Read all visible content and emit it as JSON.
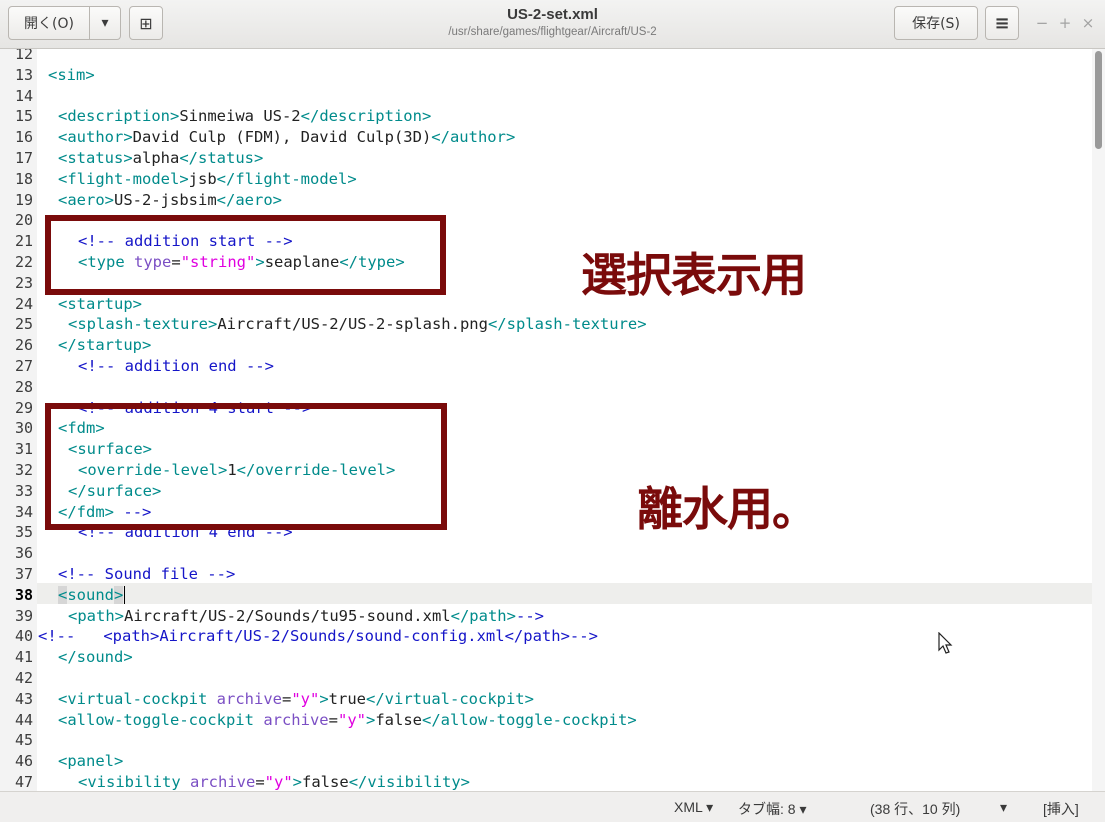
{
  "header": {
    "open_label": "開く(O)",
    "dropdown_glyph": "▾",
    "new_tab_glyph": "⊞",
    "title": "US-2-set.xml",
    "subtitle": "/usr/share/games/flightgear/Aircraft/US-2",
    "save_label": "保存(S)",
    "menu_glyph": "≡",
    "minimize_glyph": "−",
    "maximize_glyph": "+",
    "close_glyph": "×"
  },
  "editor": {
    "line_numbers": [
      "12",
      "13",
      "14",
      "15",
      "16",
      "17",
      "18",
      "19",
      "20",
      "21",
      "22",
      "23",
      "24",
      "25",
      "26",
      "27",
      "28",
      "29",
      "30",
      "31",
      "32",
      "33",
      "34",
      "35",
      "36",
      "37",
      "38",
      "39",
      "40",
      "41",
      "42",
      "43",
      "44",
      "45",
      "46",
      "47"
    ],
    "current_line": "38",
    "lines": [
      {
        "text": "<sim>"
      },
      {
        "text": "<description>Sinmeiwa US-2</description>"
      },
      {
        "text": "<author>David Culp (FDM), David Culp(3D)</author>"
      },
      {
        "text": "<status>alpha</status>"
      },
      {
        "text": "<flight-model>jsb</flight-model>"
      },
      {
        "text": "<aero>US-2-jsbsim</aero>"
      },
      {
        "text": "<!-- addition start -->"
      },
      {
        "text": "<type type=\"string\">seaplane</type>"
      },
      {
        "text": "<startup>"
      },
      {
        "text": "<splash-texture>Aircraft/US-2/US-2-splash.png</splash-texture>"
      },
      {
        "text": "</startup>"
      },
      {
        "text": "<!-- addition end -->"
      },
      {
        "text": "<!-- addition 4 start -->"
      },
      {
        "text": "<fdm>"
      },
      {
        "text": "<surface>"
      },
      {
        "text": "<override-level>1</override-level>"
      },
      {
        "text": "</surface>"
      },
      {
        "text": "</fdm> -->"
      },
      {
        "text": "<!-- addition 4 end -->"
      },
      {
        "text": "<!-- Sound file -->"
      },
      {
        "text": "<sound>"
      },
      {
        "text": "<path>Aircraft/US-2/Sounds/tu95-sound.xml</path>-->"
      },
      {
        "text": "<!--   <path>Aircraft/US-2/Sounds/sound-config.xml</path>-->"
      },
      {
        "text": "</sound>"
      },
      {
        "text": "<virtual-cockpit archive=\"y\">true</virtual-cockpit>"
      },
      {
        "text": "<allow-toggle-cockpit archive=\"y\">false</allow-toggle-cockpit>"
      },
      {
        "text": "<panel>"
      },
      {
        "text": "<visibility archive=\"y\">false</visibility>"
      }
    ]
  },
  "annotations": {
    "label1": "選択表示用",
    "label2": "離水用。"
  },
  "statusbar": {
    "language": "XML ▾",
    "tab_width": "タブ幅: 8 ▾",
    "position": "(38 行、10 列)",
    "encoding_arrow": "▾",
    "mode": "[挿入]"
  },
  "colors": {
    "tag": "#008b8b",
    "comment": "#1515c8",
    "attribute": "#7b4fc4",
    "string": "#e000e0",
    "annotation": "#7a0b0b"
  }
}
